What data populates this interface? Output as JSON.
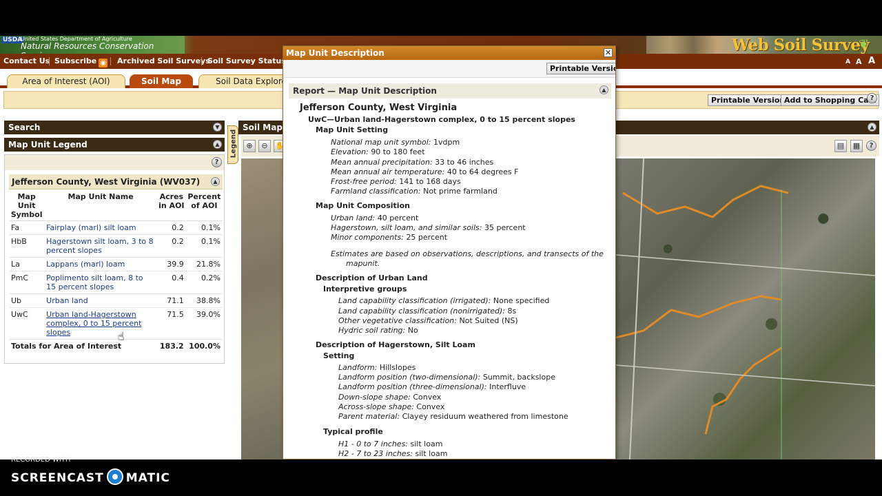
{
  "header": {
    "usda_logo": "USDA",
    "usda_dept": "United States Department of Agriculture",
    "usda_agency": "Natural Resources Conservation Service",
    "site_title": "Web Soil Survey"
  },
  "nav": {
    "contact": "Contact Us",
    "subscribe": "Subscribe",
    "archived": "Archived Soil Surveys",
    "status": "Soil Survey Status",
    "font_sizes": [
      "A",
      "A",
      "A"
    ]
  },
  "tabs": [
    {
      "label": "Area of Interest (AOI)"
    },
    {
      "label": "Soil Map"
    },
    {
      "label": "Soil Data Explorer"
    }
  ],
  "toolbar": {
    "printable": "Printable Version",
    "cart": "Add to Shopping Cart",
    "help": "?"
  },
  "panels": {
    "search": "Search",
    "legend": "Map Unit Legend",
    "legend_vtab": "Legend",
    "soil_map": "Soil Map"
  },
  "legend": {
    "county": "Jefferson County, West Virginia (WV037)",
    "columns": [
      "Map Unit Symbol",
      "Map Unit Name",
      "Acres in AOI",
      "Percent of AOI"
    ],
    "rows": [
      {
        "symbol": "Fa",
        "name": "Fairplay (marl) silt loam",
        "acres": "0.2",
        "percent": "0.1%"
      },
      {
        "symbol": "HbB",
        "name": "Hagerstown silt loam, 3 to 8 percent slopes",
        "acres": "0.2",
        "percent": "0.1%"
      },
      {
        "symbol": "La",
        "name": "Lappans (marl) loam",
        "acres": "39.9",
        "percent": "21.8%"
      },
      {
        "symbol": "PmC",
        "name": "Poplimento silt loam, 8 to 15 percent slopes",
        "acres": "0.4",
        "percent": "0.2%"
      },
      {
        "symbol": "Ub",
        "name": "Urban land",
        "acres": "71.1",
        "percent": "38.8%"
      },
      {
        "symbol": "UwC",
        "name": "Urban land-Hagerstown complex, 0 to 15 percent slopes",
        "acres": "71.5",
        "percent": "39.0%"
      }
    ],
    "total_label": "Totals for Area of Interest",
    "total_acres": "183.2",
    "total_percent": "100.0%"
  },
  "popup": {
    "title": "Map Unit Description",
    "printable": "Printable Version",
    "report_title": "Report — Map Unit Description",
    "county": "Jefferson County, West Virginia",
    "map_unit": "UwC—Urban land-Hagerstown complex, 0 to 15 percent slopes",
    "setting_heading": "Map Unit Setting",
    "setting": [
      {
        "label": "National map unit symbol:",
        "value": "1vdpm"
      },
      {
        "label": "Elevation:",
        "value": "90 to 180 feet"
      },
      {
        "label": "Mean annual precipitation:",
        "value": "33 to 46 inches"
      },
      {
        "label": "Mean annual air temperature:",
        "value": "40 to 64 degrees F"
      },
      {
        "label": "Frost-free period:",
        "value": "141 to 168 days"
      },
      {
        "label": "Farmland classification:",
        "value": "Not prime farmland"
      }
    ],
    "composition_heading": "Map Unit Composition",
    "composition": [
      {
        "label": "Urban land:",
        "value": "40 percent"
      },
      {
        "label": "Hagerstown, silt loam, and similar soils:",
        "value": "35 percent"
      },
      {
        "label": "Minor components:",
        "value": "25 percent"
      }
    ],
    "estimate_note_1": "Estimates are based on observations, descriptions, and transects of the",
    "estimate_note_2": "mapunit.",
    "urban_heading": "Description of Urban Land",
    "interpretive_heading": "Interpretive groups",
    "interpretive": [
      {
        "label": "Land capability classification (irrigated):",
        "value": "None specified"
      },
      {
        "label": "Land capability classification (nonirrigated):",
        "value": "8s"
      },
      {
        "label": "Other vegetative classification:",
        "value": "Not Suited (NS)"
      },
      {
        "label": "Hydric soil rating:",
        "value": "No"
      }
    ],
    "hagerstown_heading": "Description of Hagerstown, Silt Loam",
    "setting2_heading": "Setting",
    "setting2": [
      {
        "label": "Landform:",
        "value": "Hillslopes"
      },
      {
        "label": "Landform position (two-dimensional):",
        "value": "Summit, backslope"
      },
      {
        "label": "Landform position (three-dimensional):",
        "value": "Interfluve"
      },
      {
        "label": "Down-slope shape:",
        "value": "Convex"
      },
      {
        "label": "Across-slope shape:",
        "value": "Convex"
      },
      {
        "label": "Parent material:",
        "value": "Clayey residuum weathered from limestone"
      }
    ],
    "profile_heading": "Typical profile",
    "profile": [
      {
        "label": "H1 - 0 to 7 inches:",
        "value": "silt loam"
      },
      {
        "label": "H2 - 7 to 23 inches:",
        "value": "silt loam"
      }
    ]
  },
  "recorder": {
    "recorded_with": "RECORDED WITH",
    "brand_left": "SCREENCAST",
    "brand_right": "MATIC"
  }
}
